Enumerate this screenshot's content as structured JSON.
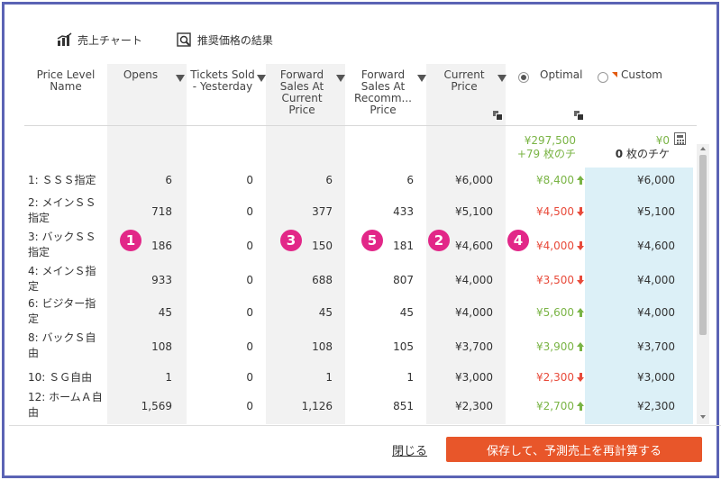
{
  "toolbar": {
    "sales_chart_label": "売上チャート",
    "recommended_results_label": "推奨価格の結果"
  },
  "columns": {
    "price_level_name": "Price Level Name",
    "opens": "Opens",
    "tickets_sold_yesterday": "Tickets Sold - Yesterday",
    "forward_sales_current": "Forward Sales At Current Price",
    "forward_sales_recomm": "Forward Sales At Recomm... Price",
    "current_price": "Current Price",
    "optimal": "Optimal",
    "custom": "Custom"
  },
  "summary": {
    "optimal_amount": "¥297,500",
    "optimal_tickets_prefix": "+79",
    "optimal_tickets_suffix": "枚のチ",
    "custom_amount": "¥0",
    "custom_tickets_count": "0",
    "custom_tickets_suffix": "枚のチケ"
  },
  "rows": [
    {
      "name": "1: ＳＳＳ指定",
      "opens": "6",
      "sold": "0",
      "fwd_current": "6",
      "fwd_recomm": "6",
      "current_price": "¥6,000",
      "optimal": "¥8,400",
      "dir": "up",
      "custom": "¥6,000"
    },
    {
      "name": "2: メインＳＳ指定",
      "opens": "718",
      "sold": "0",
      "fwd_current": "377",
      "fwd_recomm": "433",
      "current_price": "¥5,100",
      "optimal": "¥4,500",
      "dir": "down",
      "custom": "¥5,100"
    },
    {
      "name": "3: バックＳＳ指定",
      "opens": "186",
      "sold": "0",
      "fwd_current": "150",
      "fwd_recomm": "181",
      "current_price": "¥4,600",
      "optimal": "¥4,000",
      "dir": "down",
      "custom": "¥4,600"
    },
    {
      "name": "4: メインＳ指定",
      "opens": "933",
      "sold": "0",
      "fwd_current": "688",
      "fwd_recomm": "807",
      "current_price": "¥4,000",
      "optimal": "¥3,500",
      "dir": "down",
      "custom": "¥4,000"
    },
    {
      "name": "6: ビジター指定",
      "opens": "45",
      "sold": "0",
      "fwd_current": "45",
      "fwd_recomm": "45",
      "current_price": "¥4,000",
      "optimal": "¥5,600",
      "dir": "up",
      "custom": "¥4,000"
    },
    {
      "name": "8: バックＳ自由",
      "opens": "108",
      "sold": "0",
      "fwd_current": "108",
      "fwd_recomm": "105",
      "current_price": "¥3,700",
      "optimal": "¥3,900",
      "dir": "up",
      "custom": "¥3,700"
    },
    {
      "name": "10: ＳＧ自由",
      "opens": "1",
      "sold": "0",
      "fwd_current": "1",
      "fwd_recomm": "1",
      "current_price": "¥3,000",
      "optimal": "¥2,300",
      "dir": "down",
      "custom": "¥3,000"
    },
    {
      "name": "12: ホームＡ自由",
      "opens": "1,569",
      "sold": "0",
      "fwd_current": "1,126",
      "fwd_recomm": "851",
      "current_price": "¥2,300",
      "optimal": "¥2,700",
      "dir": "up",
      "custom": "¥2,300"
    }
  ],
  "markers": [
    "1",
    "2",
    "3",
    "4",
    "5"
  ],
  "footer": {
    "close_label": "閉じる",
    "save_label": "保存して、予測売上を再計算する"
  },
  "colors": {
    "frame": "#5b63b4",
    "gray_col": "#f2f2f2",
    "custom_col": "#dcf0f7",
    "green": "#7ab445",
    "red": "#e84a3a",
    "marker": "#e22788",
    "button": "#e8562a"
  }
}
